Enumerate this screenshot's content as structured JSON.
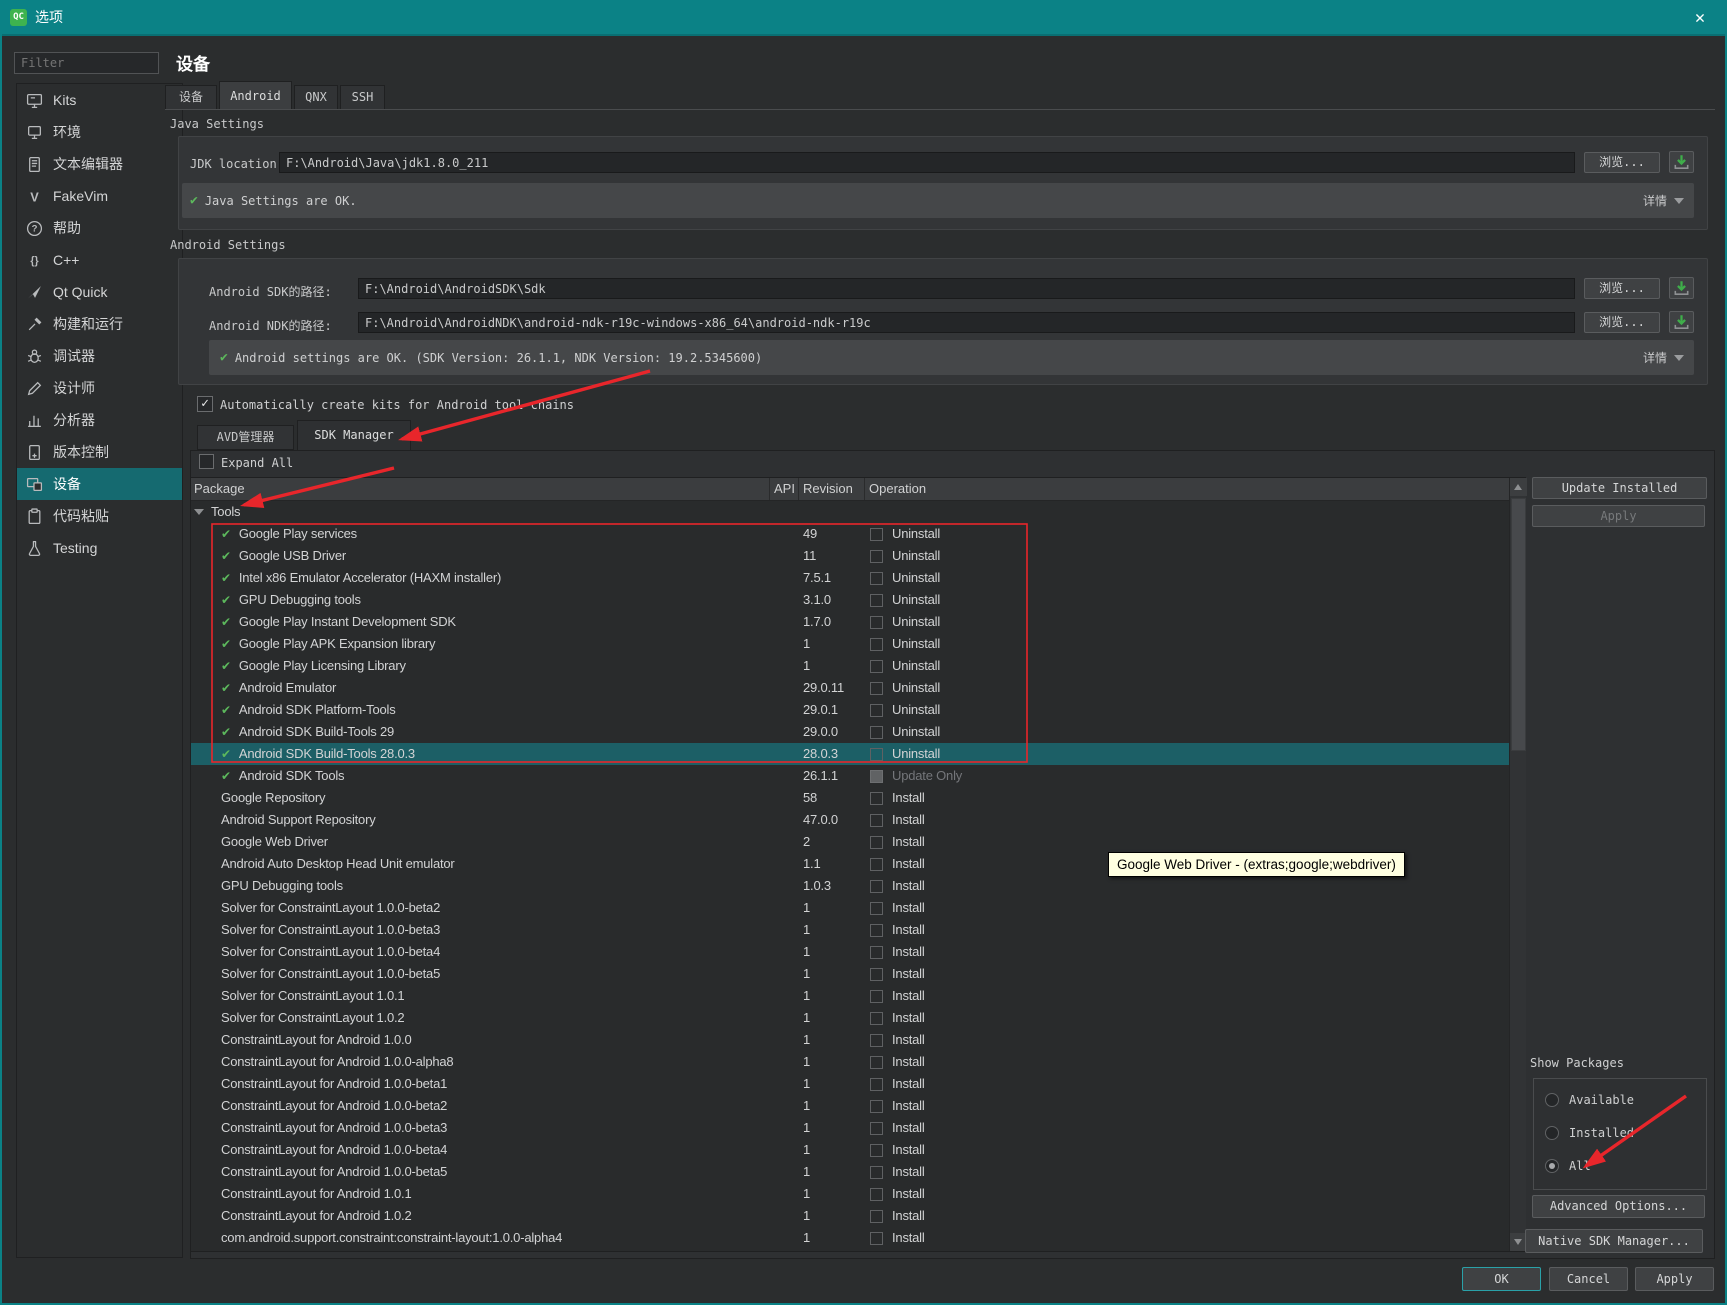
{
  "titlebar": {
    "app_badge": "QC",
    "title": "选项",
    "close": "✕"
  },
  "sidebar": {
    "filter_placeholder": "Filter",
    "items": [
      {
        "label": "Kits",
        "icon": "kits-icon"
      },
      {
        "label": "环境",
        "icon": "environment-icon"
      },
      {
        "label": "文本编辑器",
        "icon": "text-editor-icon"
      },
      {
        "label": "FakeVim",
        "icon": "fakevim-icon"
      },
      {
        "label": "帮助",
        "icon": "help-icon"
      },
      {
        "label": "C++",
        "icon": "cpp-icon"
      },
      {
        "label": "Qt Quick",
        "icon": "qt-quick-icon"
      },
      {
        "label": "构建和运行",
        "icon": "build-run-icon"
      },
      {
        "label": "调试器",
        "icon": "debugger-icon"
      },
      {
        "label": "设计师",
        "icon": "designer-icon"
      },
      {
        "label": "分析器",
        "icon": "analyzer-icon"
      },
      {
        "label": "版本控制",
        "icon": "version-control-icon"
      },
      {
        "label": "设备",
        "icon": "devices-icon",
        "selected": true
      },
      {
        "label": "代码粘贴",
        "icon": "code-paste-icon"
      },
      {
        "label": "Testing",
        "icon": "testing-icon"
      }
    ]
  },
  "page": {
    "heading": "设备",
    "tabs": [
      {
        "label": "设备"
      },
      {
        "label": "Android",
        "selected": true
      },
      {
        "label": "QNX"
      },
      {
        "label": "SSH"
      }
    ]
  },
  "java": {
    "section_label": "Java Settings",
    "jdk_label": "JDK location:",
    "jdk_value": "F:\\Android\\Java\\jdk1.8.0_211",
    "browse_label": "浏览...",
    "status_text": "Java Settings are OK.",
    "details_label": "详情"
  },
  "android": {
    "section_label": "Android Settings",
    "sdk_label": "Android SDK的路径:",
    "sdk_value": "F:\\Android\\AndroidSDK\\Sdk",
    "ndk_label": "Android NDK的路径:",
    "ndk_value": "F:\\Android\\AndroidNDK\\android-ndk-r19c-windows-x86_64\\android-ndk-r19c",
    "browse_label": "浏览...",
    "status_text": "Android settings are OK. (SDK Version: 26.1.1, NDK Version: 19.2.5345600)",
    "details_label": "详情",
    "auto_kits_label": "Automatically create kits for Android tool chains"
  },
  "manager": {
    "tabs": [
      {
        "label": "AVD管理器"
      },
      {
        "label": "SDK Manager",
        "selected": true
      }
    ],
    "expand_all_label": "Expand All",
    "columns": [
      "Package",
      "API",
      "Revision",
      "Operation"
    ],
    "group_label": "Tools",
    "rows": [
      {
        "name": "Google Play services",
        "revision": "49",
        "op": "Uninstall",
        "installed": true
      },
      {
        "name": "Google USB Driver",
        "revision": "11",
        "op": "Uninstall",
        "installed": true
      },
      {
        "name": "Intel x86 Emulator Accelerator (HAXM installer)",
        "revision": "7.5.1",
        "op": "Uninstall",
        "installed": true
      },
      {
        "name": "GPU Debugging tools",
        "revision": "3.1.0",
        "op": "Uninstall",
        "installed": true
      },
      {
        "name": "Google Play Instant Development SDK",
        "revision": "1.7.0",
        "op": "Uninstall",
        "installed": true
      },
      {
        "name": "Google Play APK Expansion library",
        "revision": "1",
        "op": "Uninstall",
        "installed": true
      },
      {
        "name": "Google Play Licensing Library",
        "revision": "1",
        "op": "Uninstall",
        "installed": true
      },
      {
        "name": "Android Emulator",
        "revision": "29.0.11",
        "op": "Uninstall",
        "installed": true
      },
      {
        "name": "Android SDK Platform-Tools",
        "revision": "29.0.1",
        "op": "Uninstall",
        "installed": true
      },
      {
        "name": "Android SDK Build-Tools 29",
        "revision": "29.0.0",
        "op": "Uninstall",
        "installed": true
      },
      {
        "name": "Android SDK Build-Tools 28.0.3",
        "revision": "28.0.3",
        "op": "Uninstall",
        "installed": true,
        "selected": true
      },
      {
        "name": "Android SDK Tools",
        "revision": "26.1.1",
        "op": "Update Only",
        "installed": true,
        "op_disabled": true,
        "op_filled": true
      },
      {
        "name": "Google Repository",
        "revision": "58",
        "op": "Install"
      },
      {
        "name": "Android Support Repository",
        "revision": "47.0.0",
        "op": "Install"
      },
      {
        "name": "Google Web Driver",
        "revision": "2",
        "op": "Install"
      },
      {
        "name": "Android Auto Desktop Head Unit emulator",
        "revision": "1.1",
        "op": "Install"
      },
      {
        "name": "GPU Debugging tools",
        "revision": "1.0.3",
        "op": "Install"
      },
      {
        "name": "Solver for ConstraintLayout 1.0.0-beta2",
        "revision": "1",
        "op": "Install"
      },
      {
        "name": "Solver for ConstraintLayout 1.0.0-beta3",
        "revision": "1",
        "op": "Install"
      },
      {
        "name": "Solver for ConstraintLayout 1.0.0-beta4",
        "revision": "1",
        "op": "Install"
      },
      {
        "name": "Solver for ConstraintLayout 1.0.0-beta5",
        "revision": "1",
        "op": "Install"
      },
      {
        "name": "Solver for ConstraintLayout 1.0.1",
        "revision": "1",
        "op": "Install"
      },
      {
        "name": "Solver for ConstraintLayout 1.0.2",
        "revision": "1",
        "op": "Install"
      },
      {
        "name": "ConstraintLayout for Android 1.0.0",
        "revision": "1",
        "op": "Install"
      },
      {
        "name": "ConstraintLayout for Android 1.0.0-alpha8",
        "revision": "1",
        "op": "Install"
      },
      {
        "name": "ConstraintLayout for Android 1.0.0-beta1",
        "revision": "1",
        "op": "Install"
      },
      {
        "name": "ConstraintLayout for Android 1.0.0-beta2",
        "revision": "1",
        "op": "Install"
      },
      {
        "name": "ConstraintLayout for Android 1.0.0-beta3",
        "revision": "1",
        "op": "Install"
      },
      {
        "name": "ConstraintLayout for Android 1.0.0-beta4",
        "revision": "1",
        "op": "Install"
      },
      {
        "name": "ConstraintLayout for Android 1.0.0-beta5",
        "revision": "1",
        "op": "Install"
      },
      {
        "name": "ConstraintLayout for Android 1.0.1",
        "revision": "1",
        "op": "Install"
      },
      {
        "name": "ConstraintLayout for Android 1.0.2",
        "revision": "1",
        "op": "Install"
      },
      {
        "name": "com.android.support.constraint:constraint-layout:1.0.0-alpha4",
        "revision": "1",
        "op": "Install"
      }
    ],
    "update_installed_label": "Update Installed",
    "apply_label": "Apply",
    "show_packages_label": "Show Packages",
    "radio_options": [
      {
        "label": "Available"
      },
      {
        "label": "Installed"
      },
      {
        "label": "All",
        "selected": true
      }
    ],
    "advanced_options_label": "Advanced Options...",
    "native_sdk_label": "Native SDK Manager..."
  },
  "tooltip": {
    "text": "Google Web Driver - (extras;google;webdriver)"
  },
  "footer": {
    "ok_label": "OK",
    "cancel_label": "Cancel",
    "apply_label": "Apply"
  },
  "colors": {
    "accent_teal": "#0b8286",
    "selection_teal": "#1c5f66",
    "annotation_red": "#e8262b",
    "check_green": "#5cb85c",
    "download_green": "#3fae4a",
    "tooltip_bg": "#ffffe1"
  }
}
